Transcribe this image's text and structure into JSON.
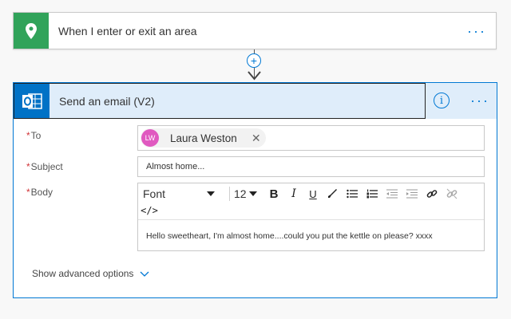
{
  "trigger": {
    "title": "When I enter or exit an area",
    "icon": "location-pin-icon",
    "color": "#31a35a",
    "more_label": "···"
  },
  "connector": {
    "add_label": "+"
  },
  "action": {
    "title": "Send an email (V2)",
    "icon": "outlook-icon",
    "color": "#0072c6",
    "info_label": "i",
    "more_label": "···"
  },
  "fields": {
    "to": {
      "label": "To",
      "required_mark": "*",
      "recipient": {
        "initials": "LW",
        "name": "Laura Weston",
        "remove_label": "✕"
      }
    },
    "subject": {
      "label": "Subject",
      "required_mark": "*",
      "value": "Almost home..."
    },
    "body": {
      "label": "Body",
      "required_mark": "*",
      "font": "Font",
      "font_size": "12",
      "text": "Hello sweetheart, I'm almost home....could you put the kettle on please? xxxx",
      "toolbar": {
        "bold": "B",
        "italic": "I",
        "underline": "U",
        "code": "</>"
      }
    }
  },
  "advanced_label": "Show advanced options"
}
